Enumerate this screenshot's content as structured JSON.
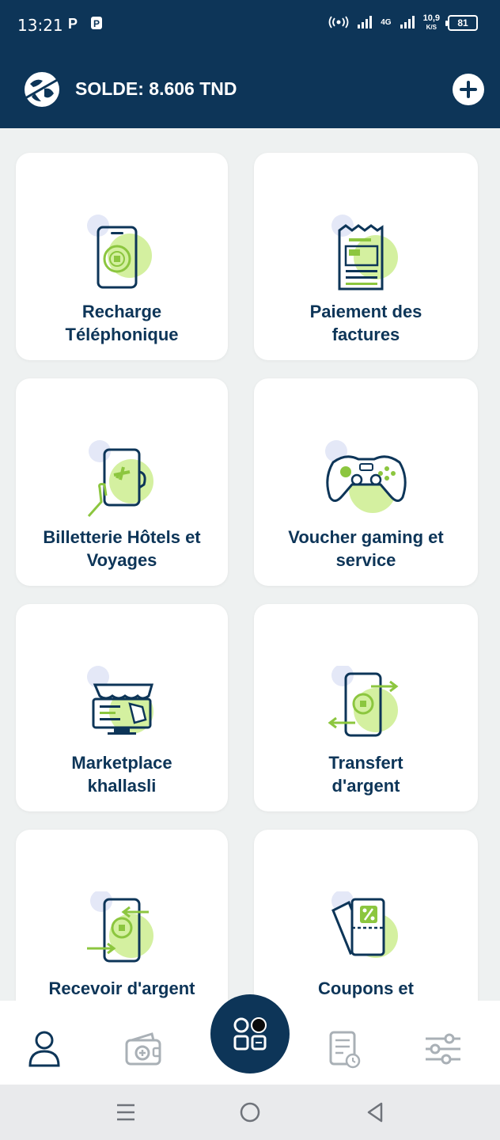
{
  "status_bar": {
    "time": "13:21",
    "left_icons": [
      "P",
      "parking-app-icon"
    ],
    "network_label": "4G",
    "speed_value": "10,9",
    "speed_unit": "K/S",
    "battery": "81"
  },
  "header": {
    "balance_text": "SOLDE: 8.606 TND",
    "logo_icon": "globe-logo-icon",
    "add_icon": "plus-circle-icon"
  },
  "services": [
    {
      "label": "Recharge\nTéléphonique",
      "icon": "phone-recharge-icon"
    },
    {
      "label": "Paiement des\nfactures",
      "icon": "bill-receipt-icon"
    },
    {
      "label": "Billetterie Hôtels et\nVoyages",
      "icon": "phone-plane-icon"
    },
    {
      "label": "Voucher gaming et\nservice",
      "icon": "gamepad-icon"
    },
    {
      "label": "Marketplace\nkhallasli",
      "icon": "storefront-icon"
    },
    {
      "label": "Transfert\nd'argent",
      "icon": "money-transfer-icon"
    },
    {
      "label": "Recevoir d'argent",
      "icon": "receive-money-icon"
    },
    {
      "label": "Coupons et",
      "icon": "coupon-icon"
    }
  ],
  "bottom_nav": [
    "profile-icon",
    "wallet-add-icon",
    "apps-icon",
    "history-icon",
    "settings-sliders-icon"
  ],
  "colors": {
    "navy": "#0d3558",
    "lime": "#d4f0a0",
    "icon_green": "#8cc63f",
    "bubble": "#e4e8f7",
    "background": "#eef1f1"
  }
}
